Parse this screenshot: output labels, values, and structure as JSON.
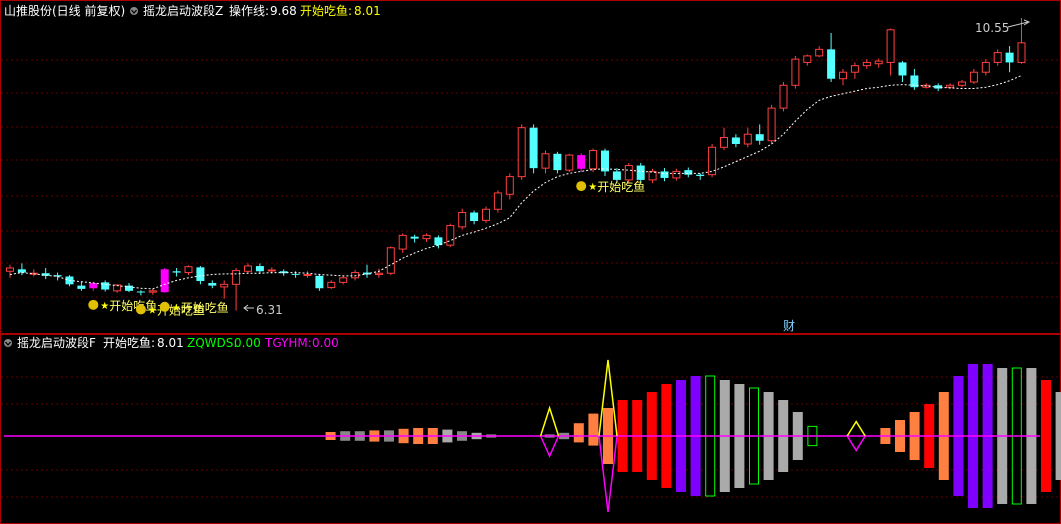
{
  "colors": {
    "bg": "#000000",
    "frame": "#aa0000",
    "grid": "#660000",
    "up": "#ff4040",
    "down": "#54ffff",
    "magenta": "#ff00ff",
    "white": "#ffffff",
    "yellow": "#ffff00",
    "gray": "#aaaaaa",
    "label": "#ffff66",
    "marker": "#e0c000",
    "orange": "#ff8040",
    "red": "#ff0000",
    "purple": "#8000ff",
    "green": "#00ff00",
    "silver": "#888888",
    "lightblue": "#7fd0ff"
  },
  "top": {
    "stock": "山推股份(日线 前复权)",
    "indicator": "摇龙启动波段Z",
    "line_label": "操作线:",
    "line_value": "9.68",
    "fish_label": "开始吃鱼:",
    "fish_value": "8.01",
    "high_note": "10.55",
    "low_note": "6.31",
    "signal_text": "开始吃鱼",
    "cai_text": "财"
  },
  "bottom": {
    "indicator": "摇龙启动波段F",
    "fish_label": "开始吃鱼:",
    "fish_value": "8.01",
    "zq_label": "ZQWDS:",
    "zq_value": "0.00",
    "tg_label": "TGYHM:",
    "tg_value": "0.00"
  },
  "chart_data": [
    {
      "type": "candlestick",
      "ylim": [
        6.1,
        10.85
      ],
      "candles": [
        [
          7.0,
          7.05,
          6.9,
          7.1
        ],
        [
          7.03,
          6.98,
          6.94,
          7.12
        ],
        [
          6.97,
          6.97,
          6.92,
          7.03
        ],
        [
          6.97,
          6.93,
          6.88,
          7.05
        ],
        [
          6.94,
          6.92,
          6.86,
          6.98
        ],
        [
          6.92,
          6.8,
          6.77,
          6.94
        ],
        [
          6.78,
          6.73,
          6.7,
          6.84
        ],
        [
          6.74,
          6.82,
          6.7,
          6.84
        ],
        [
          6.83,
          6.72,
          6.69,
          6.86
        ],
        [
          6.7,
          6.79,
          6.67,
          6.8
        ],
        [
          6.78,
          6.7,
          6.68,
          6.82
        ],
        [
          6.69,
          6.68,
          6.63,
          6.71
        ],
        [
          6.68,
          6.7,
          6.64,
          6.73
        ],
        [
          6.68,
          7.03,
          6.67,
          7.05
        ],
        [
          7.0,
          6.98,
          6.92,
          7.05
        ],
        [
          6.98,
          7.07,
          6.94,
          7.09
        ],
        [
          7.06,
          6.85,
          6.8,
          7.08
        ],
        [
          6.82,
          6.78,
          6.74,
          6.86
        ],
        [
          6.76,
          6.8,
          6.58,
          6.86
        ],
        [
          6.8,
          7.01,
          6.4,
          7.05
        ],
        [
          7.0,
          7.08,
          6.96,
          7.12
        ],
        [
          7.08,
          7.0,
          6.96,
          7.12
        ],
        [
          7.02,
          7.02,
          6.96,
          7.06
        ],
        [
          7.0,
          6.97,
          6.93,
          7.03
        ],
        [
          6.96,
          6.95,
          6.9,
          7.0
        ],
        [
          6.95,
          6.95,
          6.9,
          7.0
        ],
        [
          6.93,
          6.74,
          6.7,
          6.96
        ],
        [
          6.75,
          6.83,
          6.73,
          6.86
        ],
        [
          6.83,
          6.9,
          6.8,
          6.93
        ],
        [
          6.9,
          6.98,
          6.86,
          7.02
        ],
        [
          6.98,
          6.95,
          6.9,
          7.1
        ],
        [
          6.95,
          6.97,
          6.9,
          7.04
        ],
        [
          6.97,
          7.36,
          6.94,
          7.38
        ],
        [
          7.34,
          7.55,
          7.28,
          7.58
        ],
        [
          7.53,
          7.5,
          7.44,
          7.56
        ],
        [
          7.5,
          7.55,
          7.45,
          7.58
        ],
        [
          7.52,
          7.4,
          7.35,
          7.55
        ],
        [
          7.4,
          7.7,
          7.37,
          7.73
        ],
        [
          7.68,
          7.9,
          7.64,
          7.96
        ],
        [
          7.9,
          7.77,
          7.72,
          7.93
        ],
        [
          7.78,
          7.95,
          7.74,
          7.99
        ],
        [
          7.95,
          8.2,
          7.9,
          8.24
        ],
        [
          8.18,
          8.45,
          8.1,
          8.5
        ],
        [
          8.45,
          9.2,
          8.4,
          9.25
        ],
        [
          9.2,
          8.58,
          8.5,
          9.25
        ],
        [
          8.58,
          8.8,
          8.5,
          8.85
        ],
        [
          8.8,
          8.55,
          8.5,
          8.83
        ],
        [
          8.55,
          8.78,
          8.52,
          8.8
        ],
        [
          8.78,
          8.57,
          8.52,
          8.81
        ],
        [
          8.57,
          8.85,
          8.52,
          8.88
        ],
        [
          8.85,
          8.53,
          8.46,
          8.88
        ],
        [
          8.53,
          8.4,
          8.35,
          8.58
        ],
        [
          8.4,
          8.62,
          8.36,
          8.66
        ],
        [
          8.62,
          8.4,
          8.36,
          8.66
        ],
        [
          8.4,
          8.53,
          8.35,
          8.57
        ],
        [
          8.53,
          8.43,
          8.38,
          8.58
        ],
        [
          8.43,
          8.53,
          8.39,
          8.57
        ],
        [
          8.55,
          8.48,
          8.44,
          8.59
        ],
        [
          8.48,
          8.46,
          8.4,
          8.5
        ],
        [
          8.48,
          8.9,
          8.44,
          8.95
        ],
        [
          8.9,
          9.05,
          8.86,
          9.2
        ],
        [
          9.05,
          8.95,
          8.9,
          9.1
        ],
        [
          8.95,
          9.1,
          8.9,
          9.2
        ],
        [
          9.1,
          9.0,
          8.94,
          9.25
        ],
        [
          9.0,
          9.5,
          8.96,
          9.55
        ],
        [
          9.5,
          9.85,
          9.45,
          9.9
        ],
        [
          9.85,
          10.25,
          9.8,
          10.3
        ],
        [
          10.2,
          10.3,
          10.15,
          10.32
        ],
        [
          10.3,
          10.4,
          10.28,
          10.45
        ],
        [
          10.4,
          9.95,
          9.9,
          10.65
        ],
        [
          9.95,
          10.05,
          9.85,
          10.1
        ],
        [
          10.05,
          10.15,
          9.95,
          10.2
        ],
        [
          10.15,
          10.2,
          10.1,
          10.25
        ],
        [
          10.18,
          10.22,
          10.12,
          10.26
        ],
        [
          10.2,
          10.7,
          10.0,
          10.72
        ],
        [
          10.2,
          10.0,
          9.9,
          10.22
        ],
        [
          10.0,
          9.82,
          9.78,
          10.1
        ],
        [
          9.82,
          9.85,
          9.8,
          9.88
        ],
        [
          9.85,
          9.8,
          9.76,
          9.88
        ],
        [
          9.82,
          9.85,
          9.79,
          9.88
        ],
        [
          9.85,
          9.9,
          9.82,
          9.93
        ],
        [
          9.9,
          10.05,
          9.87,
          10.1
        ],
        [
          10.05,
          10.2,
          10.0,
          10.25
        ],
        [
          10.2,
          10.35,
          10.15,
          10.4
        ],
        [
          10.35,
          10.2,
          10.05,
          10.45
        ],
        [
          10.2,
          10.5,
          10.18,
          10.88
        ]
      ],
      "line_label": "操作线",
      "line": [
        6.95,
        6.98,
        6.96,
        6.94,
        6.92,
        6.86,
        6.84,
        6.82,
        6.8,
        6.78,
        6.76,
        6.74,
        6.73,
        6.8,
        6.86,
        6.9,
        6.93,
        6.95,
        6.96,
        6.96,
        6.97,
        6.97,
        6.98,
        6.98,
        6.98,
        6.97,
        6.95,
        6.94,
        6.93,
        6.93,
        6.96,
        7.0,
        7.1,
        7.2,
        7.28,
        7.35,
        7.4,
        7.47,
        7.55,
        7.6,
        7.66,
        7.73,
        7.82,
        8.05,
        8.23,
        8.36,
        8.45,
        8.5,
        8.53,
        8.56,
        8.57,
        8.56,
        8.55,
        8.53,
        8.52,
        8.5,
        8.5,
        8.5,
        8.5,
        8.53,
        8.6,
        8.68,
        8.76,
        8.84,
        8.95,
        9.1,
        9.3,
        9.48,
        9.62,
        9.68,
        9.72,
        9.76,
        9.8,
        9.82,
        9.85,
        9.86,
        9.85,
        9.84,
        9.82,
        9.81,
        9.8,
        9.8,
        9.82,
        9.86,
        9.92,
        10.0
      ],
      "signals": [
        7,
        11,
        13,
        48
      ],
      "magenta_candles": [
        7,
        13,
        48
      ],
      "annotations": [
        {
          "text": "10.55",
          "value": 10.55
        },
        {
          "text": "6.31",
          "value": 6.31
        }
      ]
    },
    {
      "type": "bar",
      "ylim": [
        -10,
        10
      ],
      "bars": [
        [
          0,
          0,
          "none"
        ],
        [
          0,
          0,
          "none"
        ],
        [
          0,
          0,
          "none"
        ],
        [
          0,
          0,
          "none"
        ],
        [
          0,
          0,
          "none"
        ],
        [
          0,
          0,
          "none"
        ],
        [
          0,
          0,
          "none"
        ],
        [
          0,
          0,
          "none"
        ],
        [
          0,
          0,
          "none"
        ],
        [
          0,
          0,
          "none"
        ],
        [
          0,
          0,
          "none"
        ],
        [
          0.5,
          0.5,
          "orange"
        ],
        [
          0.6,
          0.6,
          "silver"
        ],
        [
          0.6,
          0.6,
          "silver"
        ],
        [
          0.7,
          0.7,
          "orange"
        ],
        [
          0.7,
          0.7,
          "silver"
        ],
        [
          0.9,
          0.9,
          "orange"
        ],
        [
          1.0,
          1.0,
          "orange"
        ],
        [
          1.0,
          1.0,
          "orange"
        ],
        [
          0.8,
          0.8,
          "gray"
        ],
        [
          0.6,
          0.6,
          "silver"
        ],
        [
          0.4,
          0.4,
          "gray"
        ],
        [
          0.2,
          0.2,
          "silver"
        ],
        [
          0,
          0,
          "none"
        ],
        [
          0,
          0,
          "none"
        ],
        [
          0,
          0,
          "none"
        ],
        [
          0.2,
          0.2,
          "silver"
        ],
        [
          0.4,
          0.4,
          "silver"
        ],
        [
          1.6,
          0.8,
          "orange"
        ],
        [
          2.8,
          1.2,
          "orange"
        ],
        [
          3.5,
          3.5,
          "orange"
        ],
        [
          4.5,
          4.5,
          "red"
        ],
        [
          4.5,
          4.5,
          "red"
        ],
        [
          5.5,
          5.5,
          "red"
        ],
        [
          6.5,
          6.5,
          "red"
        ],
        [
          7.0,
          7.0,
          "purple"
        ],
        [
          7.5,
          7.5,
          "purple"
        ],
        [
          7.5,
          7.5,
          "green"
        ],
        [
          7.0,
          7.0,
          "gray"
        ],
        [
          6.5,
          6.5,
          "gray"
        ],
        [
          6.0,
          6.0,
          "green"
        ],
        [
          5.5,
          5.5,
          "gray"
        ],
        [
          4.5,
          4.5,
          "gray"
        ],
        [
          3.0,
          3.0,
          "gray"
        ],
        [
          1.2,
          1.2,
          "green"
        ],
        [
          0,
          0,
          "none"
        ],
        [
          0,
          0,
          "none"
        ],
        [
          0,
          0,
          "none"
        ],
        [
          0,
          0,
          "none"
        ],
        [
          1.0,
          1.0,
          "orange"
        ],
        [
          2.0,
          2.0,
          "orange"
        ],
        [
          3.0,
          3.0,
          "orange"
        ],
        [
          4.0,
          4.0,
          "red"
        ],
        [
          5.5,
          5.5,
          "orange"
        ],
        [
          7.5,
          7.5,
          "purple"
        ],
        [
          9.0,
          9.0,
          "purple"
        ],
        [
          9.0,
          9.0,
          "purple"
        ],
        [
          8.5,
          8.5,
          "gray"
        ],
        [
          8.5,
          8.5,
          "green"
        ],
        [
          8.5,
          8.5,
          "gray"
        ],
        [
          7.0,
          7.0,
          "red"
        ],
        [
          5.5,
          5.5,
          "gray"
        ],
        [
          3.5,
          3.5,
          "gray"
        ],
        [
          2.0,
          2.0,
          "silver"
        ],
        [
          1.8,
          1.8,
          "silver"
        ],
        [
          1.8,
          1.8,
          "green"
        ],
        [
          1.8,
          1.8,
          "silver"
        ],
        [
          2.0,
          2.0,
          "orange"
        ],
        [
          1.8,
          1.8,
          "green"
        ]
      ],
      "markers": [
        {
          "index": 26,
          "up": 3.5,
          "down": 2.5,
          "color": "yellow"
        },
        {
          "index": 30,
          "up": 9.5,
          "down": 9.5,
          "color": "yellow"
        },
        {
          "index": 47,
          "up": 1.8,
          "down": 1.8,
          "color": "yellow"
        }
      ]
    }
  ]
}
